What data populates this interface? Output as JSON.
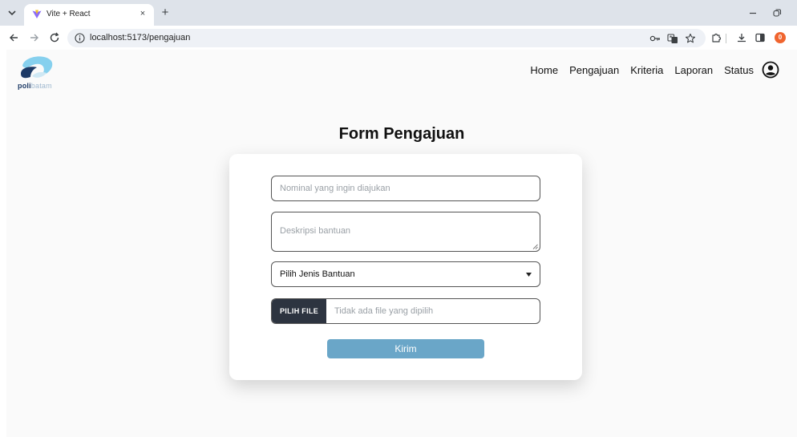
{
  "browser": {
    "tab_title": "Vite + React",
    "new_tab_symbol": "+",
    "close_symbol": "×",
    "url": "localhost:5173/pengajuan",
    "profile_badge": "0"
  },
  "site": {
    "logo_part1": "poli",
    "logo_part2": "batam",
    "nav": [
      "Home",
      "Pengajuan",
      "Kriteria",
      "Laporan",
      "Status"
    ]
  },
  "form": {
    "title": "Form Pengajuan",
    "nominal_placeholder": "Nominal yang ingin diajukan",
    "deskripsi_placeholder": "Deskripsi bantuan",
    "jenis_selected": "Pilih Jenis Bantuan",
    "file_button": "PILIH FILE",
    "file_status": "Tidak ada file yang dipilih",
    "submit_label": "Kirim"
  },
  "colors": {
    "submit": "#6aa6c8",
    "file_button": "#2d3440",
    "logo_dark": "#1d3a66",
    "logo_light": "#9fb8cf"
  }
}
